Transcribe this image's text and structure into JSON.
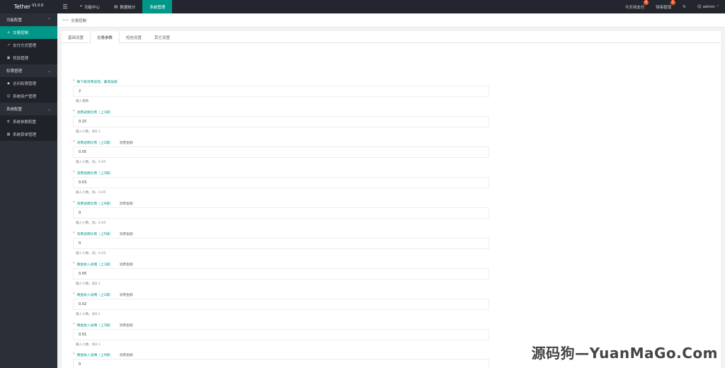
{
  "brand": {
    "name": "Tether",
    "version": "V1.0.0"
  },
  "top_menu": [
    {
      "icon": "globe-icon",
      "glyph": "⌖",
      "label": "功能中心"
    },
    {
      "icon": "database-icon",
      "glyph": "▤",
      "label": "数据统计"
    },
    {
      "icon": "",
      "glyph": "",
      "label": "系统管理"
    }
  ],
  "top_right": {
    "today_pay": {
      "label": "今天待支付",
      "badge": "0"
    },
    "pending": {
      "label": "待审提现",
      "badge": "1"
    },
    "user": "admin"
  },
  "sidebar": {
    "groups": [
      {
        "label": "功能配置",
        "items": [
          {
            "icon": "home-icon",
            "glyph": "⌂",
            "label": "交易控制"
          },
          {
            "icon": "link-icon",
            "glyph": "↗",
            "label": "支付方式管理"
          },
          {
            "icon": "image-icon",
            "glyph": "▣",
            "label": "奖励管理"
          }
        ]
      },
      {
        "label": "权限管理",
        "items": [
          {
            "icon": "shield-icon",
            "glyph": "◆",
            "label": "访问权限管理"
          },
          {
            "icon": "user-icon",
            "glyph": "☺",
            "label": "系统用户管理"
          }
        ]
      },
      {
        "label": "系统配置",
        "items": [
          {
            "icon": "gear-icon",
            "glyph": "⚙",
            "label": "系统参数配置"
          },
          {
            "icon": "calendar-icon",
            "glyph": "▦",
            "label": "系统菜单管理"
          }
        ]
      }
    ]
  },
  "breadcrumb": "交易控制",
  "tabs": [
    "基础设置",
    "交易参数",
    "短信设置",
    "其它设置"
  ],
  "form_fields": [
    {
      "label": "每下级消费返现，最高层级",
      "extra": "",
      "value": "2",
      "hint": "输入整数"
    },
    {
      "label": "消费返佣比例（上1级）",
      "extra": "",
      "value": "0.15",
      "hint": "输入小数，如0.1"
    },
    {
      "label": "消费返佣比例（上2级）",
      "extra": "消费金额",
      "value": "0.05",
      "hint": "输入小数，如，0.05"
    },
    {
      "label": "消费返佣比例（上3级）",
      "extra": "",
      "value": "0.03",
      "hint": "输入小数，如，0.05"
    },
    {
      "label": "消费返佣比例（上4级）",
      "extra": "消费金额",
      "value": "0",
      "hint": "输入小数，如，0.05"
    },
    {
      "label": "消费返佣比例（上5级）",
      "extra": "消费金额",
      "value": "0",
      "hint": "输入小数，如，0.05"
    },
    {
      "label": "佣金收入返佣（上1级）",
      "extra": "消费金额",
      "value": "0.05",
      "hint": "输入小数，如0.1"
    },
    {
      "label": "佣金收入返佣（上2级）",
      "extra": "消费金额",
      "value": "0.02",
      "hint": "输入小数，如0.1"
    },
    {
      "label": "佣金收入返佣（上3级）",
      "extra": "消费金额",
      "value": "0.01",
      "hint": "输入小数，如0.1"
    },
    {
      "label": "佣金收入返佣（上4级）",
      "extra": "消费金额",
      "value": "0",
      "hint": "输入小数，如0.1"
    }
  ],
  "watermark": "源码狗—YuanMaGo.Com",
  "colors": {
    "accent": "#009688",
    "topbar": "#23262e",
    "sidebar": "#2b2f38",
    "badge": "#ff5722"
  }
}
